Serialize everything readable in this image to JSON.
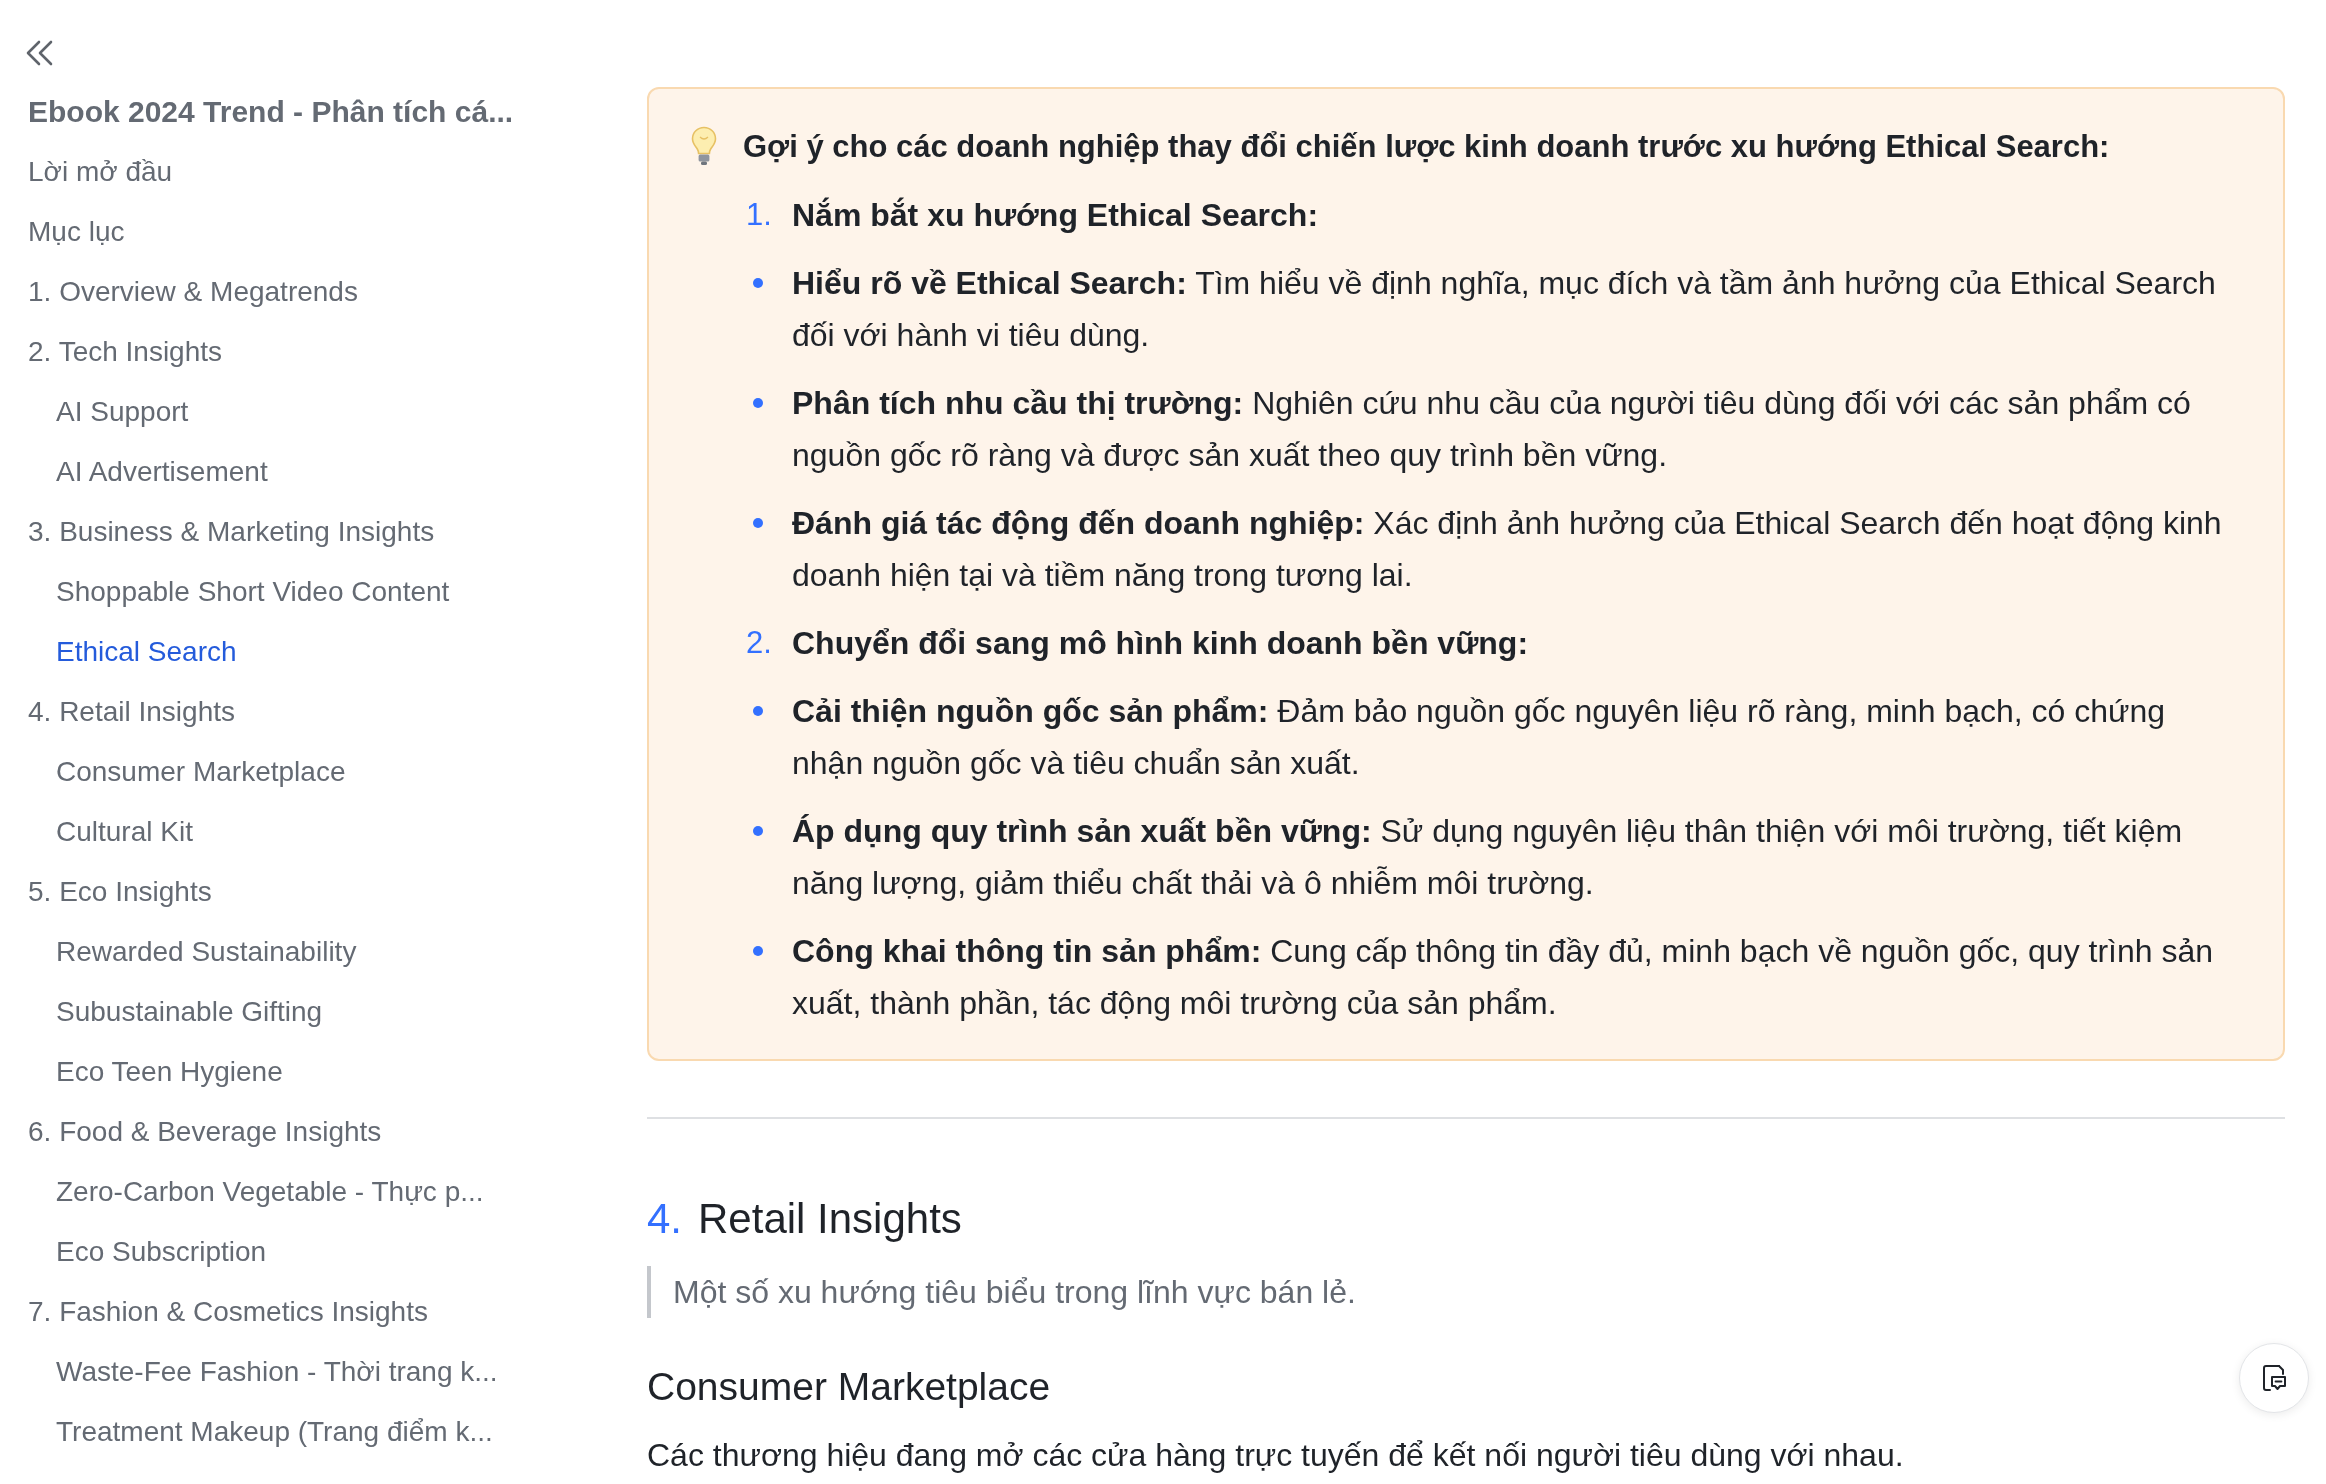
{
  "sidebar": {
    "title": "Ebook 2024 Trend - Phân tích cá...",
    "items": [
      {
        "label": "Lời mở đầu",
        "selected": false
      },
      {
        "label": "Mục lục",
        "selected": false
      },
      {
        "label": "1. Overview & Megatrends",
        "selected": false
      },
      {
        "label": "2. Tech Insights",
        "selected": false,
        "children": [
          {
            "label": "AI Support",
            "selected": false
          },
          {
            "label": "AI Advertisement",
            "selected": false
          }
        ]
      },
      {
        "label": "3. Business & Marketing Insights",
        "selected": false,
        "children": [
          {
            "label": "Shoppable Short Video Content",
            "selected": false
          },
          {
            "label": "Ethical Search",
            "selected": true
          }
        ]
      },
      {
        "label": "4. Retail Insights",
        "selected": false,
        "children": [
          {
            "label": "Consumer Marketplace",
            "selected": false
          },
          {
            "label": "Cultural Kit",
            "selected": false
          }
        ]
      },
      {
        "label": "5. Eco Insights",
        "selected": false,
        "children": [
          {
            "label": "Rewarded Sustainability",
            "selected": false
          },
          {
            "label": "Subustainable Gifting",
            "selected": false
          },
          {
            "label": "Eco Teen Hygiene",
            "selected": false
          }
        ]
      },
      {
        "label": "6. Food & Beverage Insights",
        "selected": false,
        "children": [
          {
            "label": "Zero-Carbon Vegetable - Thực p...",
            "selected": false
          },
          {
            "label": "Eco Subscription",
            "selected": false
          }
        ]
      },
      {
        "label": "7. Fashion & Cosmetics Insights",
        "selected": false,
        "children": [
          {
            "label": "Waste-Fee Fashion - Thời trang k...",
            "selected": false
          },
          {
            "label": "Treatment Makeup (Trang điểm k...",
            "selected": false
          }
        ]
      }
    ]
  },
  "callout": {
    "title": "Gợi ý cho các doanh nghiệp thay đổi chiến lược kinh doanh trước xu hướng Ethical Search:",
    "items": [
      {
        "kind": "numbered",
        "number": "1.",
        "text": "**Nắm bắt xu hướng Ethical Search:**"
      },
      {
        "kind": "bullet",
        "text": "**Hiểu rõ về Ethical Search:** Tìm hiểu về định nghĩa, mục đích và tầm ảnh hưởng của Ethical Search đối với hành vi tiêu dùng."
      },
      {
        "kind": "bullet",
        "text": "**Phân tích nhu cầu thị trường:** Nghiên cứu nhu cầu của người tiêu dùng đối với các sản phẩm có nguồn gốc rõ ràng và được sản xuất theo quy trình bền vững."
      },
      {
        "kind": "bullet",
        "text": "**Đánh giá tác động đến doanh nghiệp:** Xác định ảnh hưởng của Ethical Search đến hoạt động kinh doanh hiện tại và tiềm năng trong tương lai."
      },
      {
        "kind": "numbered",
        "number": "2.",
        "text": "**Chuyển đổi sang mô hình kinh doanh bền vững:**"
      },
      {
        "kind": "bullet",
        "text": "**Cải thiện nguồn gốc sản phẩm:** Đảm bảo nguồn gốc nguyên liệu rõ ràng, minh bạch, có chứng nhận nguồn gốc và tiêu chuẩn sản xuất."
      },
      {
        "kind": "bullet",
        "text": "**Áp dụng quy trình sản xuất bền vững:** Sử dụng nguyên liệu thân thiện với môi trường, tiết kiệm năng lượng, giảm thiểu chất thải và ô nhiễm môi trường."
      },
      {
        "kind": "bullet",
        "text": "**Công khai thông tin sản phẩm:** Cung cấp thông tin đầy đủ, minh bạch về nguồn gốc, quy trình sản xuất, thành phần, tác động môi trường của sản phẩm."
      }
    ]
  },
  "section": {
    "number": "4.",
    "title": "Retail Insights",
    "quote": "Một số xu hướng tiêu biểu trong lĩnh vực bán lẻ.",
    "subheading": "Consumer Marketplace",
    "paragraph": "Các thương hiệu đang mở các cửa hàng trực tuyến để kết nối người tiêu dùng với nhau."
  }
}
